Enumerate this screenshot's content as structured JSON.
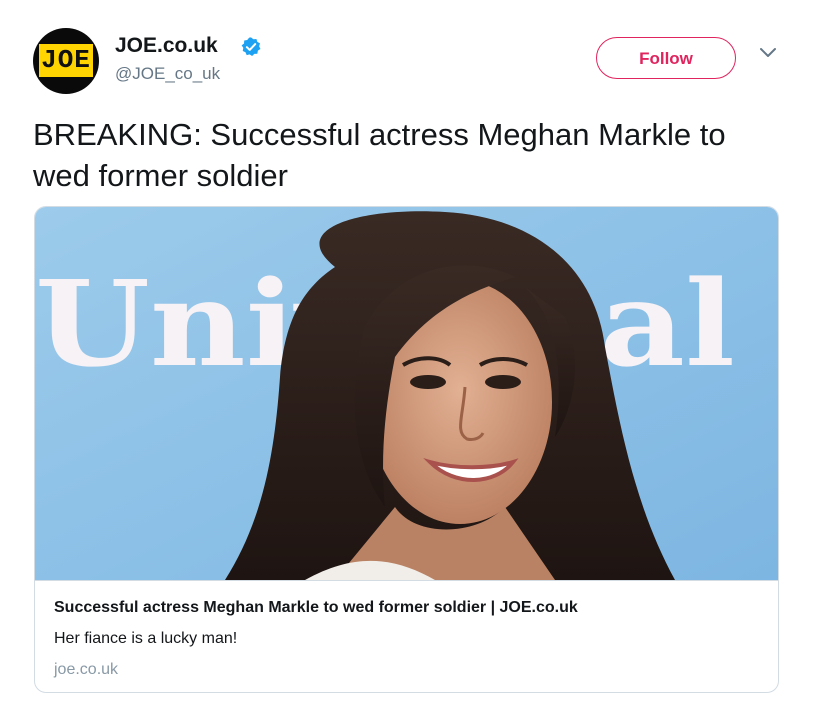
{
  "account": {
    "avatar_text": "JOE",
    "display_name": "JOE.co.uk",
    "handle": "@JOE_co_uk",
    "verified_icon": "verified-badge-icon",
    "avatar_colors": {
      "background": "#0a0a0a",
      "logo": "#ffd400"
    }
  },
  "actions": {
    "follow_label": "Follow",
    "menu_icon": "chevron-down-icon",
    "follow_color": "#e0245e"
  },
  "tweet": {
    "text": "BREAKING: Successful actress Meghan Markle to wed former soldier"
  },
  "card": {
    "image_backdrop_text": "Universal",
    "title": "Successful actress Meghan Markle to wed former soldier | JOE.co.uk",
    "description": "Her fiance is a lucky man!",
    "domain": "joe.co.uk"
  },
  "colors": {
    "verified": "#1da1f2",
    "secondary_text": "#657786",
    "card_border": "#d3dce3",
    "image_background": "#8fc3e8"
  }
}
